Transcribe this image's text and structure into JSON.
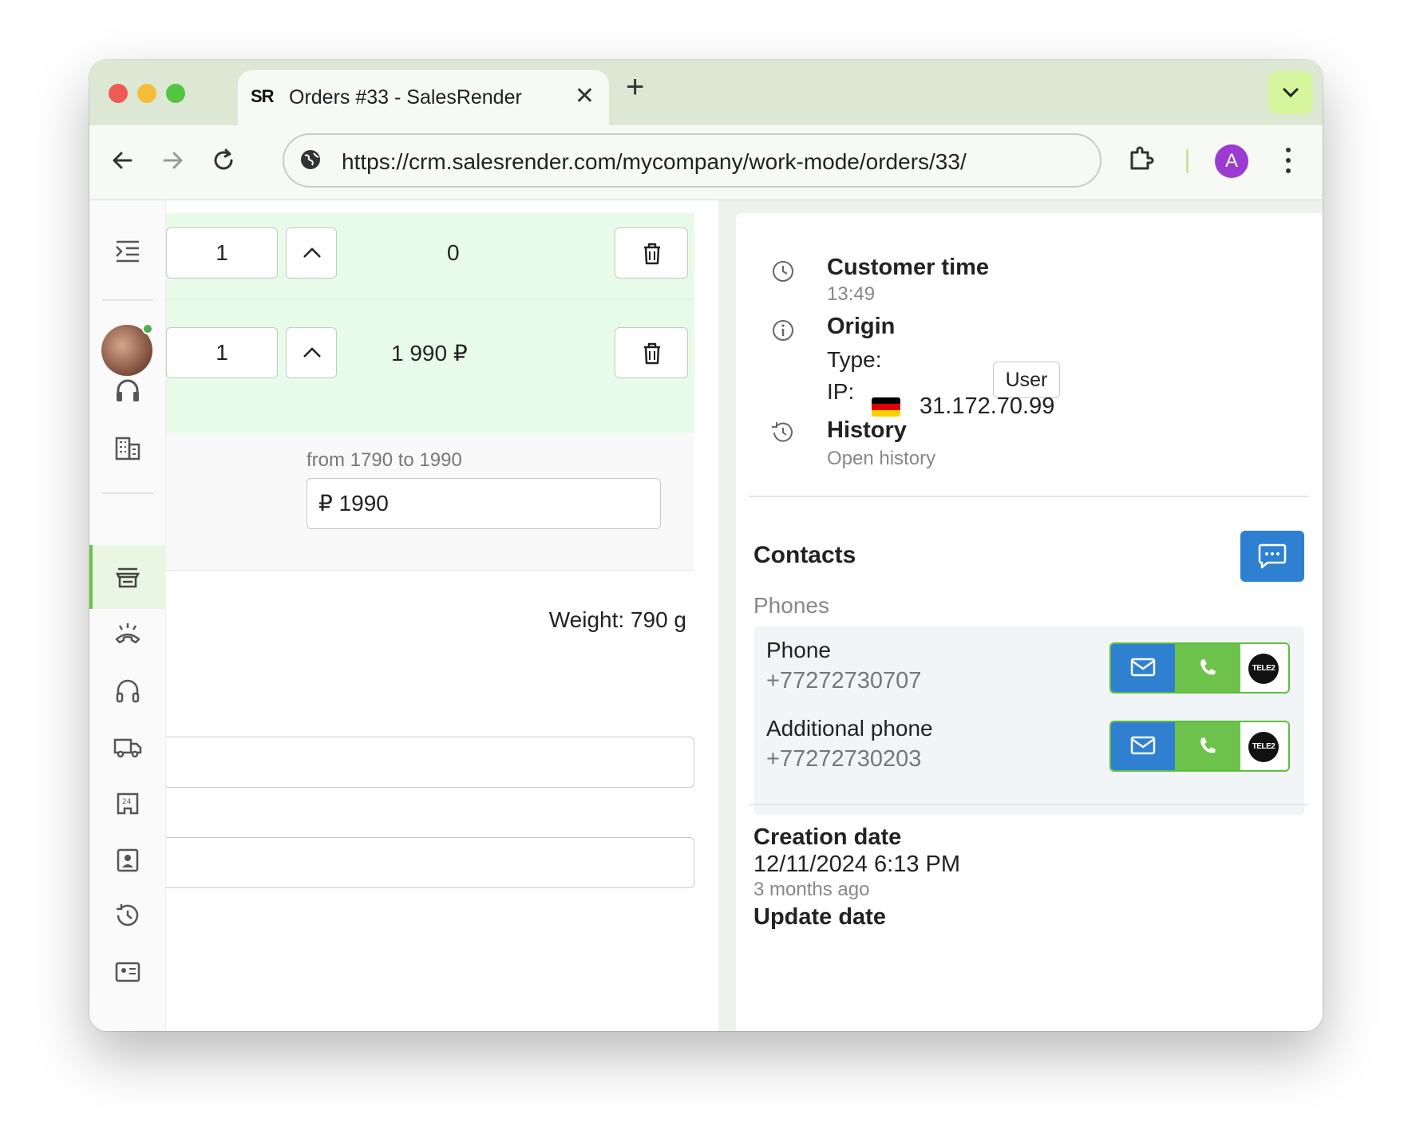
{
  "browser": {
    "tab_title": "Orders #33 - SalesRender",
    "tab_favicon": "SR",
    "url": "https://crm.salesrender.com/mycompany/work-mode/orders/33/",
    "profile_initial": "A",
    "colors": {
      "titlebar": "#dce8d3",
      "toolbar": "#f7faf4",
      "profile": "#9b3bd3",
      "tab_menu": "#d7f59c"
    }
  },
  "order_items": [
    {
      "quantity": "1",
      "total": "0"
    },
    {
      "quantity": "1",
      "total": "1 990 ₽"
    }
  ],
  "price_range": {
    "label": "from 1790 to 1990",
    "value": "₽ 1990"
  },
  "weight": "Weight: 790 g",
  "customer_time": {
    "label": "Customer time",
    "value": "13:49"
  },
  "origin": {
    "label": "Origin",
    "type_label": "Type:",
    "type_value": "User",
    "ip_label": "IP:",
    "ip_value": "31.172.70.99"
  },
  "history": {
    "label": "History",
    "link": "Open history"
  },
  "contacts": {
    "title": "Contacts",
    "phones_label": "Phones",
    "phones": [
      {
        "label": "Phone",
        "number": "+77272730707",
        "operator": "TELE2"
      },
      {
        "label": "Additional phone",
        "number": "+77272730203",
        "operator": "TELE2"
      }
    ]
  },
  "dates": {
    "creation_label": "Creation date",
    "creation_value": "12/11/2024 6:13 PM",
    "creation_relative": "3 months ago",
    "update_label": "Update date"
  },
  "accent_colors": {
    "green": "#6cc24a",
    "blue": "#2f80d1",
    "row_highlight": "#e8fbe8"
  }
}
